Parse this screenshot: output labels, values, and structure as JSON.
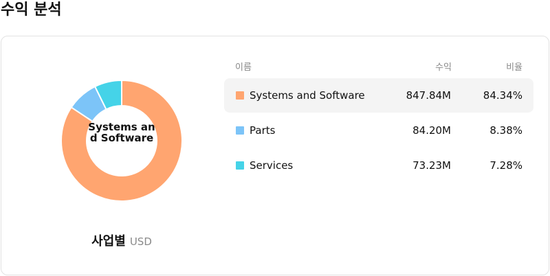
{
  "page": {
    "title": "수익 분석"
  },
  "donut": {
    "center_label": "Systems and Software"
  },
  "caption": {
    "main": "사업별",
    "unit": "USD"
  },
  "table": {
    "headers": {
      "name": "이름",
      "revenue": "수익",
      "rate": "비율"
    },
    "rows": [
      {
        "name": "Systems and Software",
        "revenue": "847.84M",
        "rate": "84.34%",
        "color": "#FFA570",
        "selected": true
      },
      {
        "name": "Parts",
        "revenue": "84.20M",
        "rate": "8.38%",
        "color": "#7CC4F8",
        "selected": false
      },
      {
        "name": "Services",
        "revenue": "73.23M",
        "rate": "7.28%",
        "color": "#45D3E8",
        "selected": false
      }
    ]
  },
  "chart_data": {
    "type": "pie",
    "categories": [
      "Systems and Software",
      "Parts",
      "Services"
    ],
    "values": [
      84.34,
      8.38,
      7.28
    ],
    "colors": [
      "#FFA570",
      "#7CC4F8",
      "#45D3E8"
    ],
    "selected_index": 0
  }
}
